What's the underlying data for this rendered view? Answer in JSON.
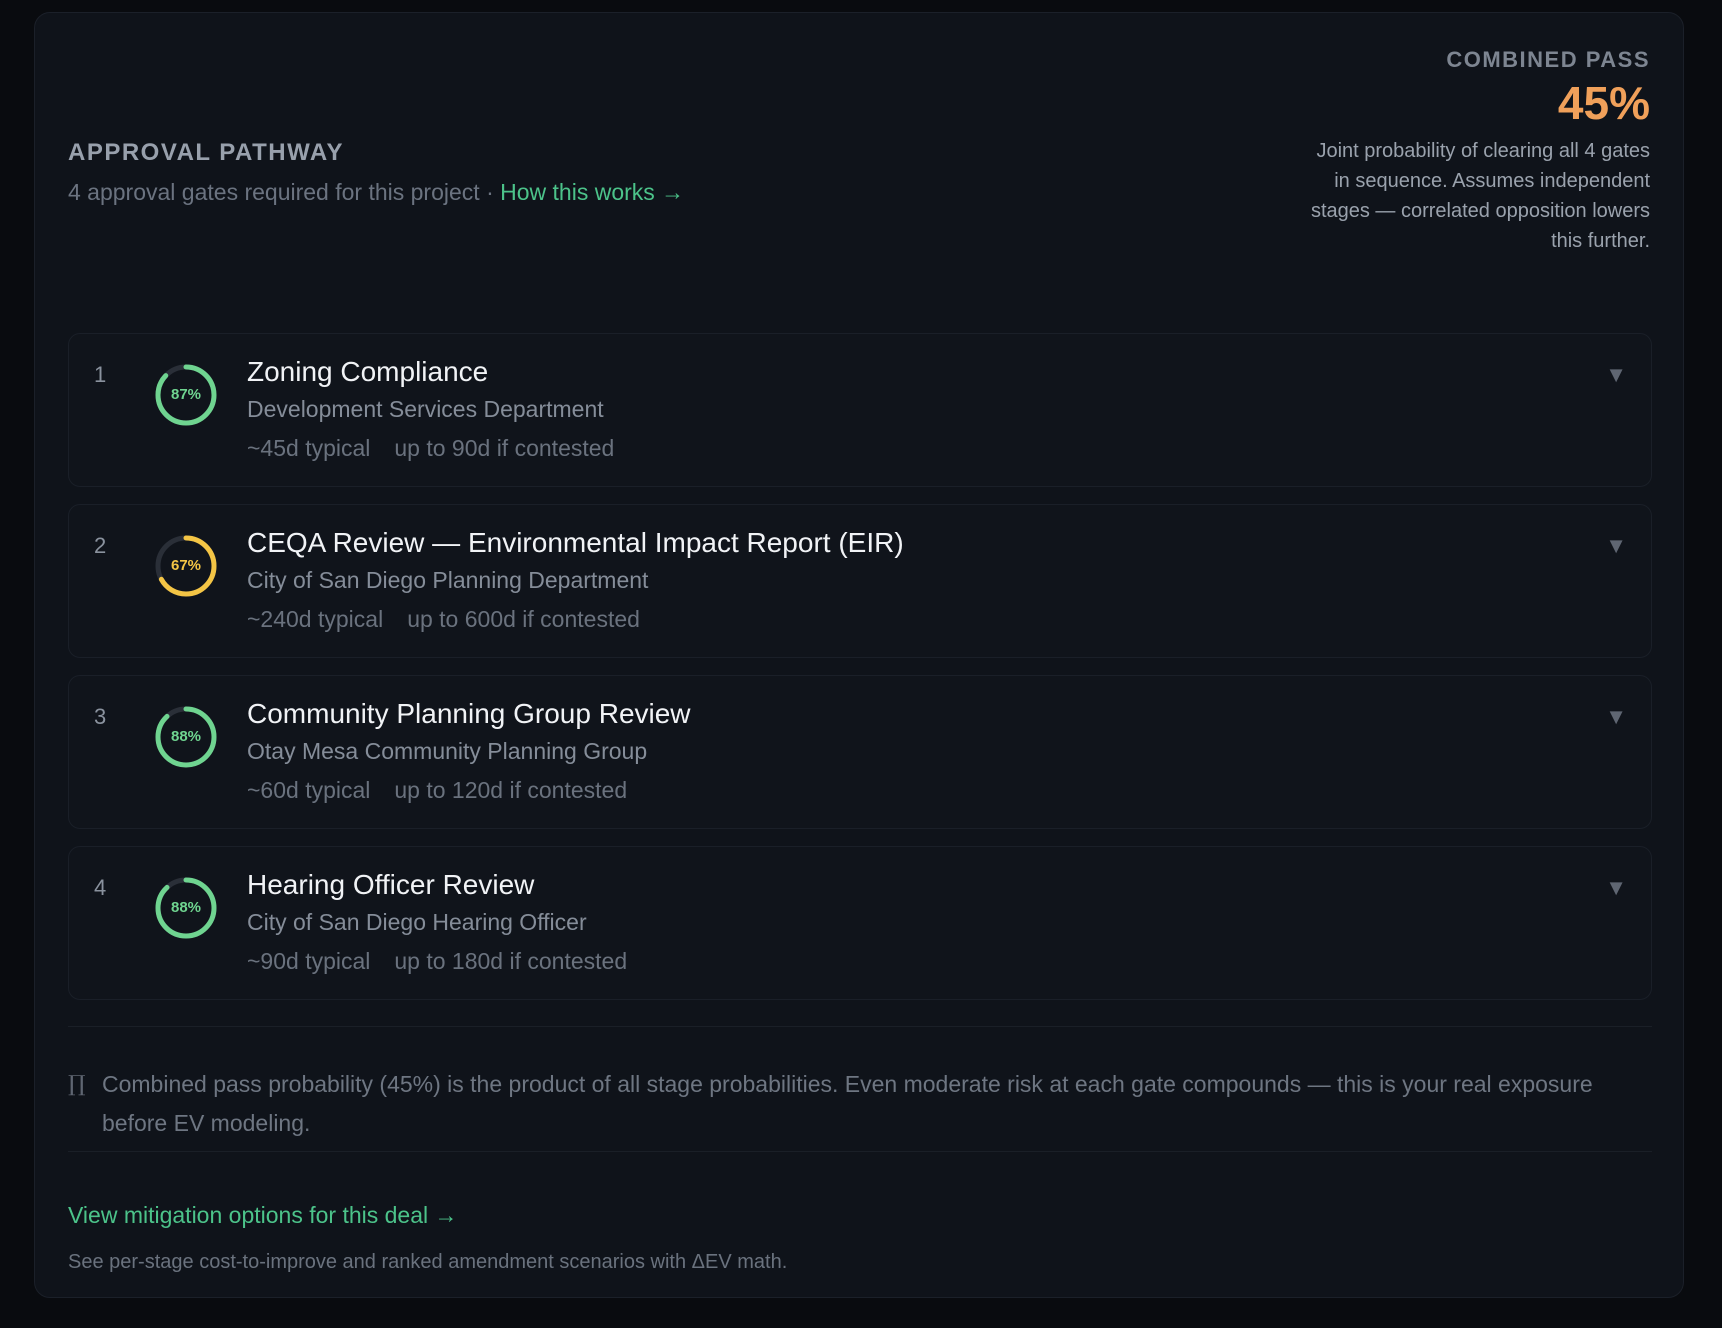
{
  "header": {
    "eyebrow": "APPROVAL PATHWAY",
    "subtitle": "4 approval gates required for this project ·",
    "how_link": "How this works →"
  },
  "combined": {
    "label": "COMBINED PASS",
    "value": "45%",
    "description": "Joint probability of clearing all 4 gates in sequence. Assumes independent stages — correlated opposition lowers this further."
  },
  "colors": {
    "green": "#6fd490",
    "yellow": "#f4c545",
    "track": "#2a2f38",
    "accent_orange": "#f0a05a",
    "link_green": "#4cc38a"
  },
  "gates": [
    {
      "number": "1",
      "percent_label": "87%",
      "probability": 0.87,
      "status_color": "green",
      "title": "Zoning Compliance",
      "department": "Development Services Department",
      "typical": "~45d typical",
      "contested": "up to 90d if contested",
      "chevron_icon": "chevron-down-icon"
    },
    {
      "number": "2",
      "percent_label": "67%",
      "probability": 0.67,
      "status_color": "yellow",
      "title": "CEQA Review — Environmental Impact Report (EIR)",
      "department": "City of San Diego Planning Department",
      "typical": "~240d typical",
      "contested": "up to 600d if contested",
      "chevron_icon": "chevron-down-icon"
    },
    {
      "number": "3",
      "percent_label": "88%",
      "probability": 0.88,
      "status_color": "green",
      "title": "Community Planning Group Review",
      "department": "Otay Mesa Community Planning Group",
      "typical": "~60d typical",
      "contested": "up to 120d if contested",
      "chevron_icon": "chevron-down-icon"
    },
    {
      "number": "4",
      "percent_label": "88%",
      "probability": 0.88,
      "status_color": "green",
      "title": "Hearing Officer Review",
      "department": "City of San Diego Hearing Officer",
      "typical": "~90d typical",
      "contested": "up to 180d if contested",
      "chevron_icon": "chevron-down-icon"
    }
  ],
  "note": {
    "icon": "pi-icon",
    "symbol": "∏",
    "text": "Combined pass probability (45%) is the product of all stage probabilities. Even moderate risk at each gate compounds — this is your real exposure before EV modeling."
  },
  "mitigation": {
    "link": "View mitigation options for this deal →",
    "subtitle": "See per-stage cost-to-improve and ranked amendment scenarios with ΔEV math."
  }
}
